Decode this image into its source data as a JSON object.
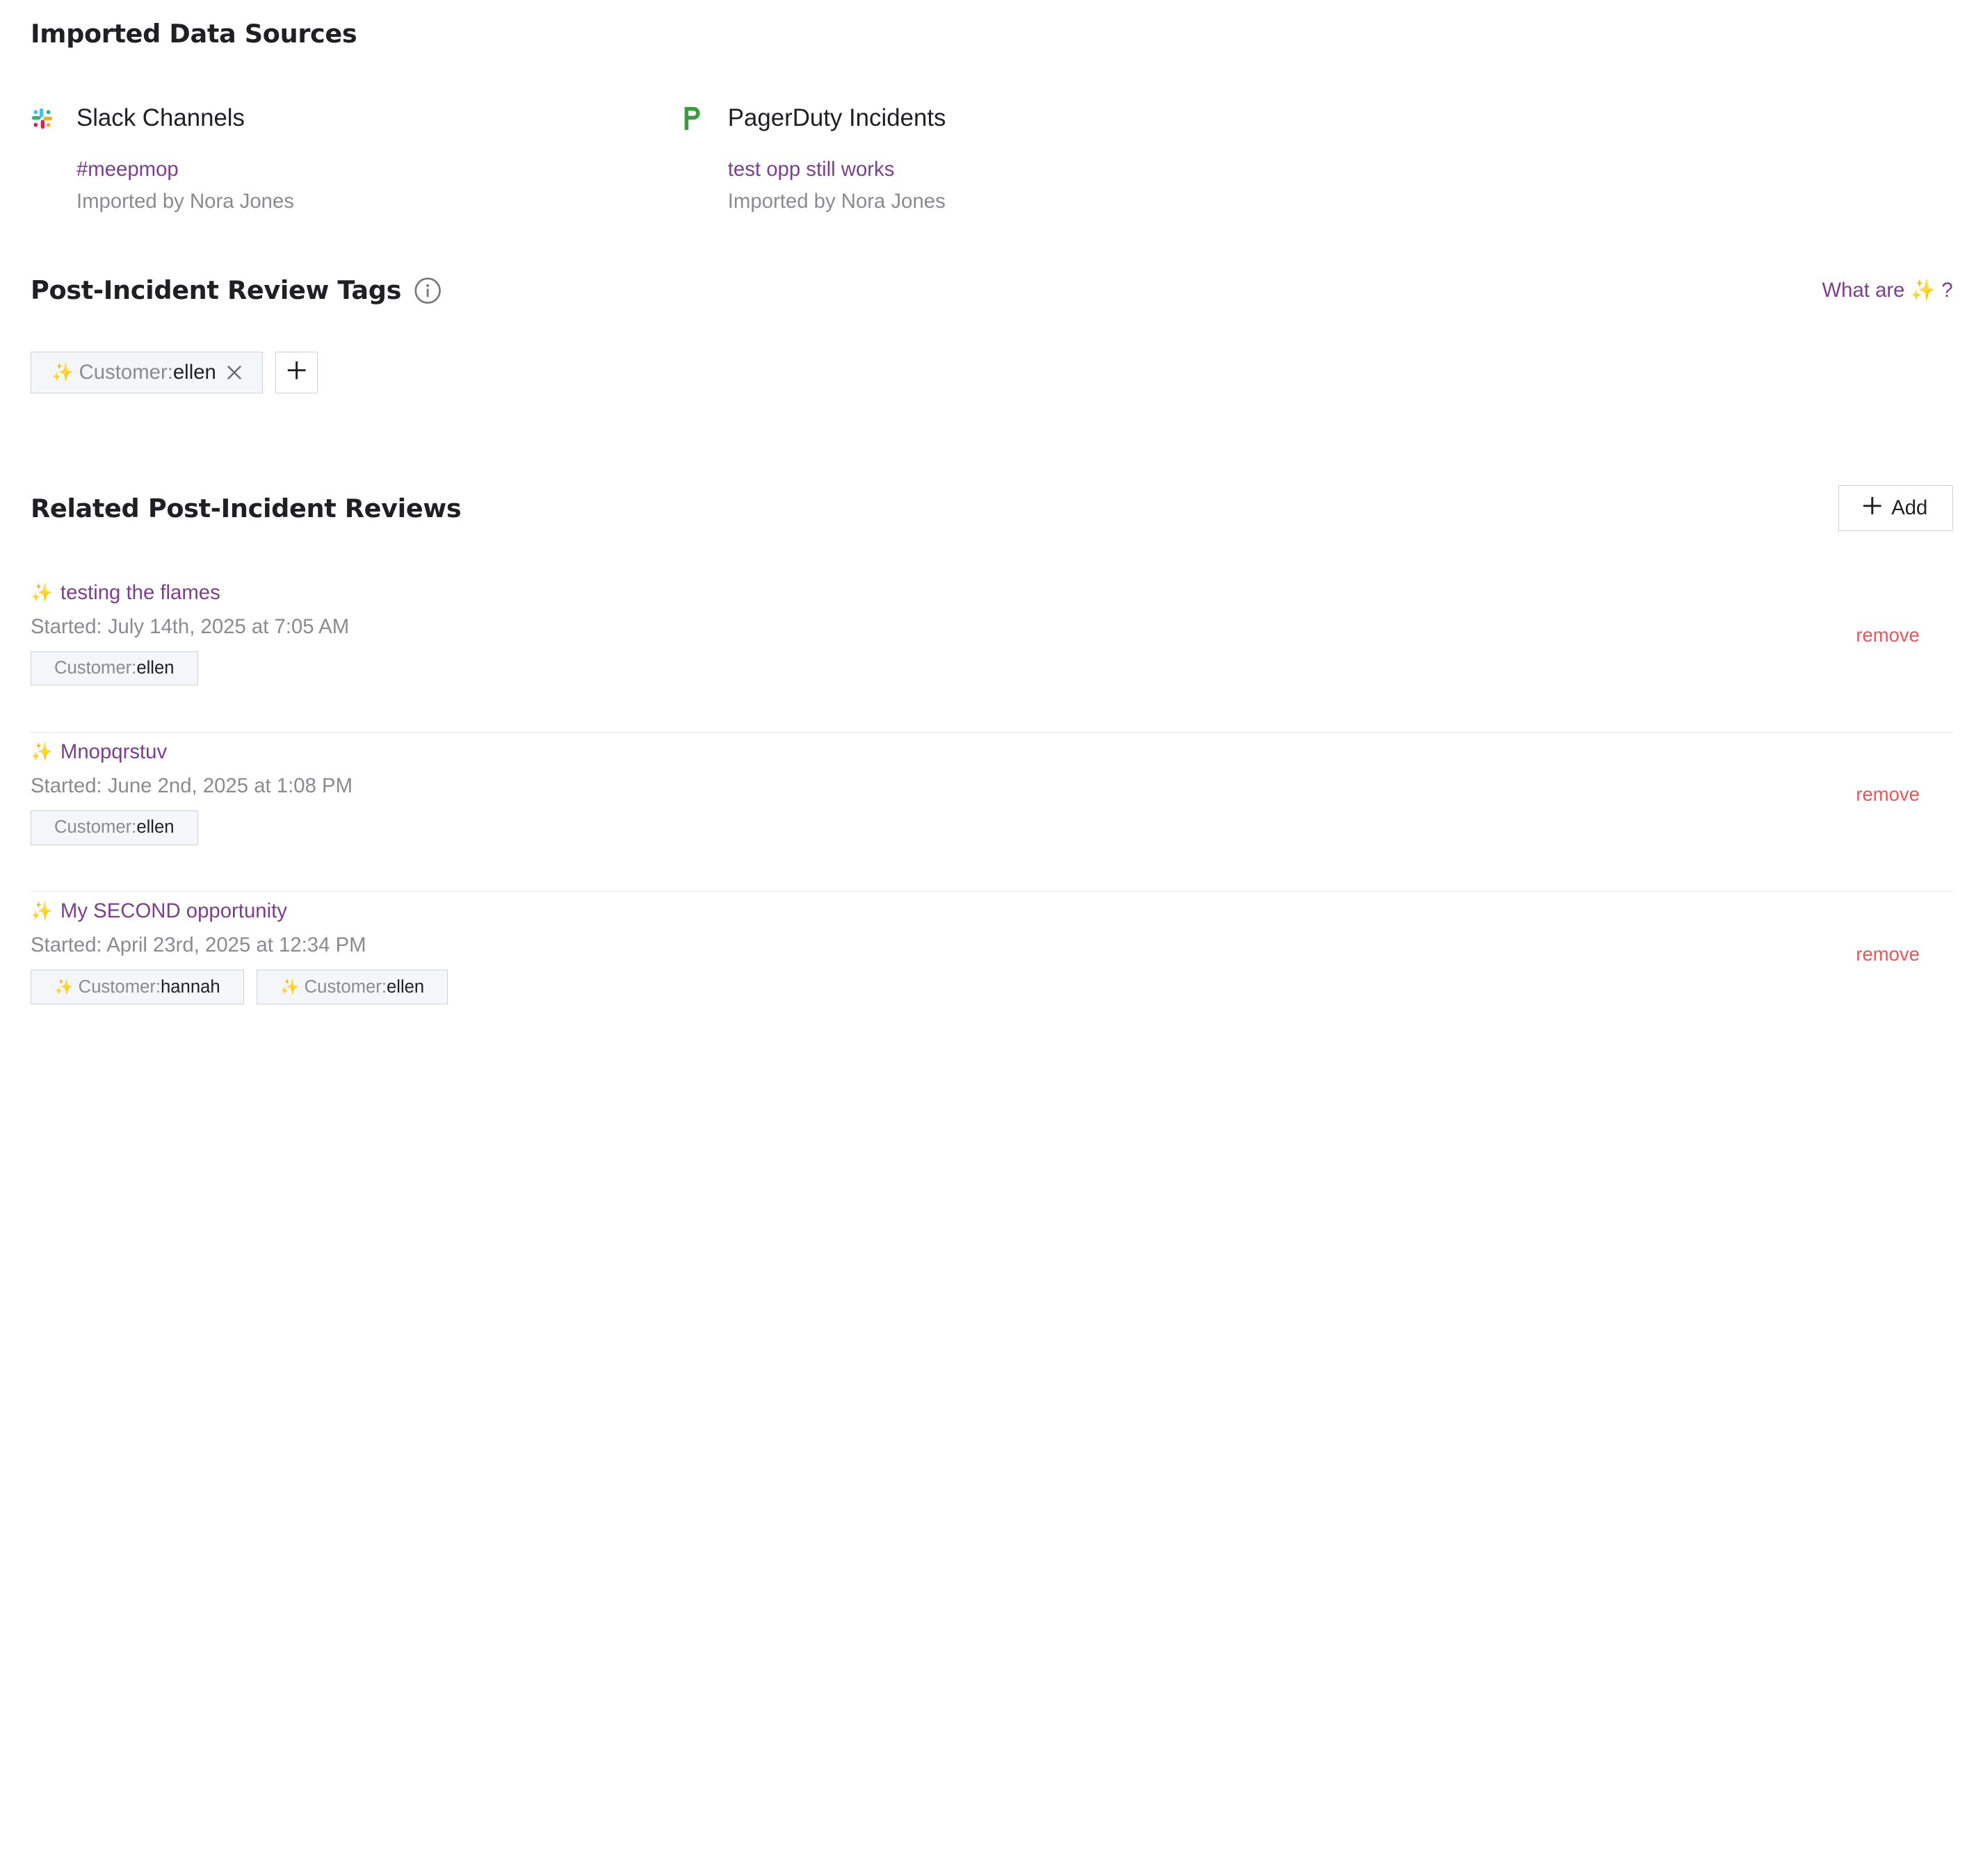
{
  "imported": {
    "title": "Imported Data Sources",
    "sources": [
      {
        "icon": "slack-icon",
        "name": "Slack Channels",
        "link": "#meepmop",
        "meta": "Imported by Nora Jones"
      },
      {
        "icon": "pagerduty-icon",
        "name": "PagerDuty Incidents",
        "link": "test opp still works",
        "meta": "Imported by Nora Jones"
      }
    ]
  },
  "tags": {
    "title": "Post-Incident Review Tags",
    "info_icon": "info-icon",
    "what_are": {
      "text": "What are",
      "sparkle": "✨",
      "q": "?"
    },
    "items": [
      {
        "sparkle": "✨",
        "key": "Customer:",
        "value": "ellen"
      }
    ]
  },
  "related": {
    "title": "Related Post-Incident Reviews",
    "add_label": "Add",
    "reviews": [
      {
        "sparkle": "✨",
        "title": "testing the flames",
        "started": "Started: July 14th, 2025 at 7:05 AM",
        "tags": [
          {
            "sparkle": "",
            "key": "Customer:",
            "value": "ellen"
          }
        ],
        "remove": "remove"
      },
      {
        "sparkle": "✨",
        "title": "Mnopqrstuv",
        "started": "Started: June 2nd, 2025 at 1:08 PM",
        "tags": [
          {
            "sparkle": "",
            "key": "Customer:",
            "value": "ellen"
          }
        ],
        "remove": "remove"
      },
      {
        "sparkle": "✨",
        "title": "My SECOND opportunity",
        "started": "Started: April 23rd, 2025 at 12:34 PM",
        "tags": [
          {
            "sparkle": "✨",
            "key": "Customer:",
            "value": "hannah"
          },
          {
            "sparkle": "✨",
            "key": "Customer:",
            "value": "ellen"
          }
        ],
        "remove": "remove"
      }
    ]
  },
  "colors": {
    "link": "#7b3f8d",
    "remove": "#e8555c",
    "sparkle": "#e8c547",
    "pagerduty": "#3a9c3a"
  }
}
